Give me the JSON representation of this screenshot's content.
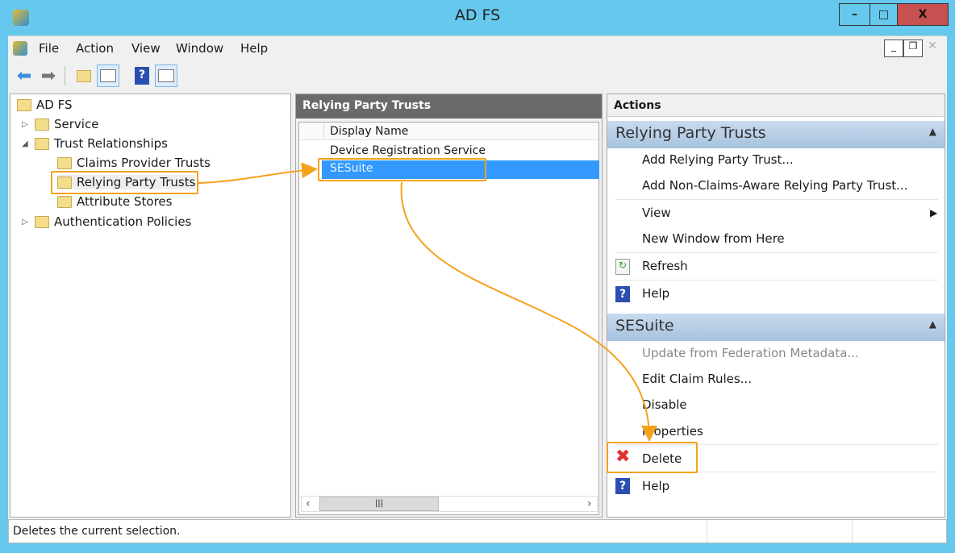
{
  "window": {
    "title": "AD FS",
    "minimize": "–",
    "maximize": "□",
    "close": "X"
  },
  "menu": [
    "File",
    "Action",
    "View",
    "Window",
    "Help"
  ],
  "toolbar": {
    "icons": [
      "back-arrow-icon",
      "forward-arrow-icon",
      "up-folder-icon",
      "show-hide-tree-icon",
      "help-icon",
      "show-hide-action-pane-icon"
    ]
  },
  "tree": {
    "items": [
      {
        "label": "AD FS"
      },
      {
        "label": "Service"
      },
      {
        "label": "Trust Relationships"
      },
      {
        "label": "Claims Provider Trusts"
      },
      {
        "label": "Relying Party Trusts"
      },
      {
        "label": "Attribute Stores"
      },
      {
        "label": "Authentication Policies"
      }
    ]
  },
  "middle": {
    "title": "Relying Party Trusts",
    "column": "Display Name",
    "rows": [
      "Device Registration Service",
      "SESuite"
    ],
    "selected": "SESuite"
  },
  "actions": {
    "title": "Actions",
    "group1": {
      "title": "Relying Party Trusts",
      "items": [
        "Add Relying Party Trust...",
        "Add Non-Claims-Aware Relying Party Trust...",
        "View",
        "New Window from Here",
        "Refresh",
        "Help"
      ]
    },
    "group2": {
      "title": "SESuite",
      "items": [
        "Update from Federation Metadata...",
        "Edit Claim Rules...",
        "Disable",
        "Properties",
        "Delete",
        "Help"
      ]
    }
  },
  "status": {
    "text": "Deletes the current selection."
  },
  "colors": {
    "highlight": "#f5a21b",
    "selection": "#3399ff",
    "titlebar": "#66c8ec",
    "close": "#c75050"
  }
}
